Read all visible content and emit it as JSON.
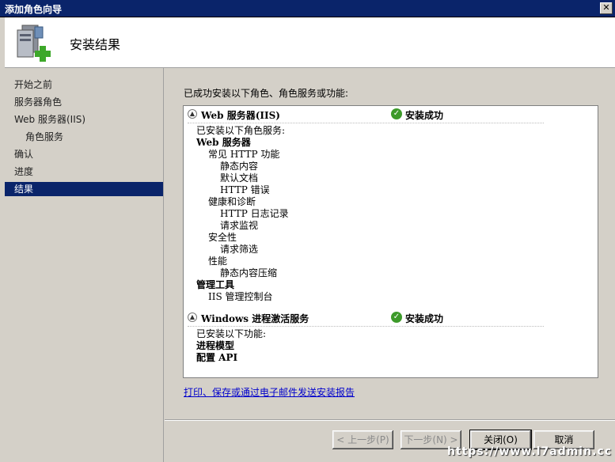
{
  "window": {
    "title": "添加角色向导",
    "close_label": "✕"
  },
  "header": {
    "title": "安装结果"
  },
  "sidebar": {
    "items": [
      {
        "label": "开始之前"
      },
      {
        "label": "服务器角色"
      },
      {
        "label": "Web 服务器(IIS)"
      },
      {
        "label": "角色服务"
      },
      {
        "label": "确认"
      },
      {
        "label": "进度"
      },
      {
        "label": "结果"
      }
    ]
  },
  "main": {
    "intro": "已成功安装以下角色、角色服务或功能:",
    "sections": [
      {
        "title": "Web 服务器(IIS)",
        "status": "安装成功",
        "lines": [
          {
            "text": "已安装以下角色服务:"
          },
          {
            "text": "Web 服务器"
          },
          {
            "text": "常见 HTTP 功能"
          },
          {
            "text": "静态内容"
          },
          {
            "text": "默认文档"
          },
          {
            "text": "HTTP 错误"
          },
          {
            "text": "健康和诊断"
          },
          {
            "text": "HTTP 日志记录"
          },
          {
            "text": "请求监视"
          },
          {
            "text": "安全性"
          },
          {
            "text": "请求筛选"
          },
          {
            "text": "性能"
          },
          {
            "text": "静态内容压缩"
          },
          {
            "text": "管理工具"
          },
          {
            "text": "IIS 管理控制台"
          }
        ]
      },
      {
        "title": "Windows 进程激活服务",
        "status": "安装成功",
        "lines": [
          {
            "text": "已安装以下功能:"
          },
          {
            "text": "进程模型"
          },
          {
            "text": "配置 API"
          }
        ]
      }
    ],
    "report_link": "打印、保存或通过电子邮件发送安装报告"
  },
  "buttons": {
    "prev": "< 上一步(P)",
    "next": "下一步(N) >",
    "close": "关闭(O)",
    "cancel": "取消"
  },
  "watermark": "https://www.l7admin.cc",
  "colors": {
    "title_bar": "#0a246a",
    "selected_nav": "#0a246a",
    "success": "#3d9a2a",
    "link": "#0000cc"
  }
}
